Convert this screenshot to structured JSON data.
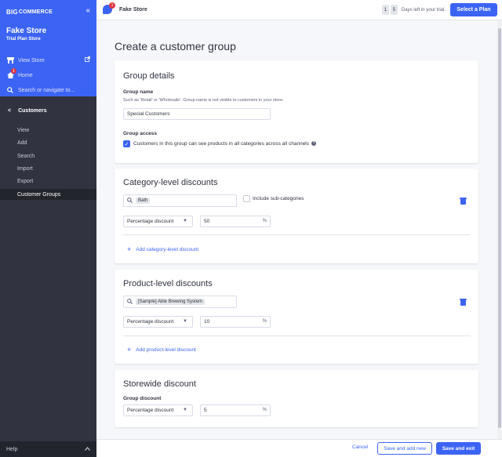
{
  "sidebar": {
    "logo_mark": "BIG",
    "logo_text": "COMMERCE",
    "collapse_icon": "«",
    "store_name": "Fake Store",
    "store_plan": "Trial Plan Store",
    "view_store": "View Store",
    "home": "Home",
    "home_badge": "1",
    "search_placeholder": "Search or navigate to...",
    "section": "Customers",
    "items": [
      {
        "label": "View"
      },
      {
        "label": "Add"
      },
      {
        "label": "Search"
      },
      {
        "label": "Import"
      },
      {
        "label": "Export"
      },
      {
        "label": "Customer Groups"
      }
    ],
    "help": "Help"
  },
  "topbar": {
    "store_name": "Fake Store",
    "notification_count": "1",
    "trial_digit_1": "1",
    "trial_digit_2": "5",
    "trial_text": "Days left in your trial.",
    "plan_button": "Select a Plan"
  },
  "page": {
    "title": "Create a customer group"
  },
  "group_details": {
    "title": "Group details",
    "name_label": "Group name",
    "name_hint": "Such as 'Retail' or 'Wholesale'. Group name is not visible to customers in your store.",
    "name_value": "Special Customers",
    "access_label": "Group access",
    "access_checkbox_label": "Customers in this group can see products in all categories across all channels",
    "access_checked": true
  },
  "category_discounts": {
    "title": "Category-level discounts",
    "search_tag": "Bath",
    "include_sub_label": "Include sub-categories",
    "include_sub_checked": false,
    "discount_type": "Percentage discount",
    "discount_value": "50",
    "suffix": "%",
    "add_link": "Add category-level discount"
  },
  "product_discounts": {
    "title": "Product-level discounts",
    "search_tag": "[Sample] Able Brewing System",
    "discount_type": "Percentage discount",
    "discount_value": "10",
    "suffix": "%",
    "add_link": "Add product-level discount"
  },
  "storewide_discount": {
    "title": "Storewide discount",
    "group_label": "Group discount",
    "discount_type": "Percentage discount",
    "discount_value": "5",
    "suffix": "%"
  },
  "footer": {
    "cancel": "Cancel",
    "save_add_new": "Save and add new",
    "save_exit": "Save and exit"
  },
  "colors": {
    "accent": "#3c64f4",
    "sidebar": "#313440",
    "danger": "#db3643"
  }
}
